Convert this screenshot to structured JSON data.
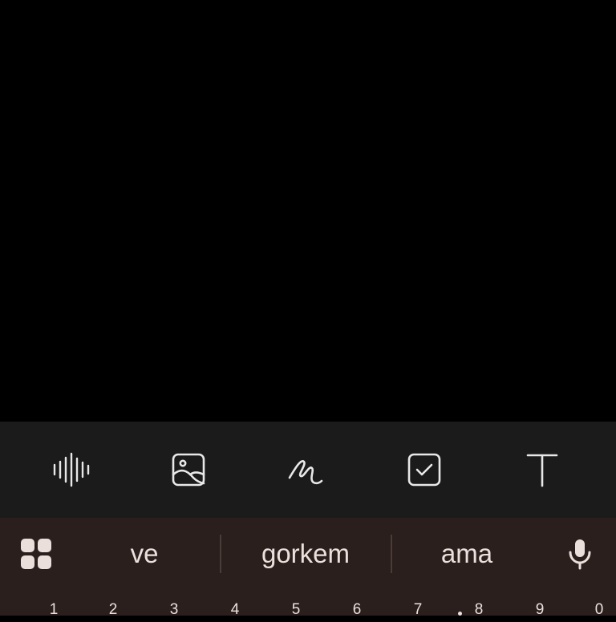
{
  "toolbar": {
    "tools": [
      {
        "name": "voice-recording",
        "icon": "audio-waveform-icon"
      },
      {
        "name": "image",
        "icon": "image-icon"
      },
      {
        "name": "drawing",
        "icon": "handwriting-squiggle-icon"
      },
      {
        "name": "checklist",
        "icon": "checkbox-icon"
      },
      {
        "name": "text-format",
        "icon": "text-format-icon"
      }
    ]
  },
  "keyboard": {
    "apps_icon": "grid-apps-icon",
    "suggestions": [
      "ve",
      "gorkem",
      "ama"
    ],
    "mic_icon": "microphone-icon",
    "number_row": [
      "1",
      "2",
      "3",
      "4",
      "5",
      "6",
      "7",
      "8",
      "9",
      "0"
    ]
  },
  "colors": {
    "background": "#000000",
    "toolbar": "#1b1b1b",
    "keyboard": "#2a1f1c",
    "text": "#ece0dc"
  }
}
